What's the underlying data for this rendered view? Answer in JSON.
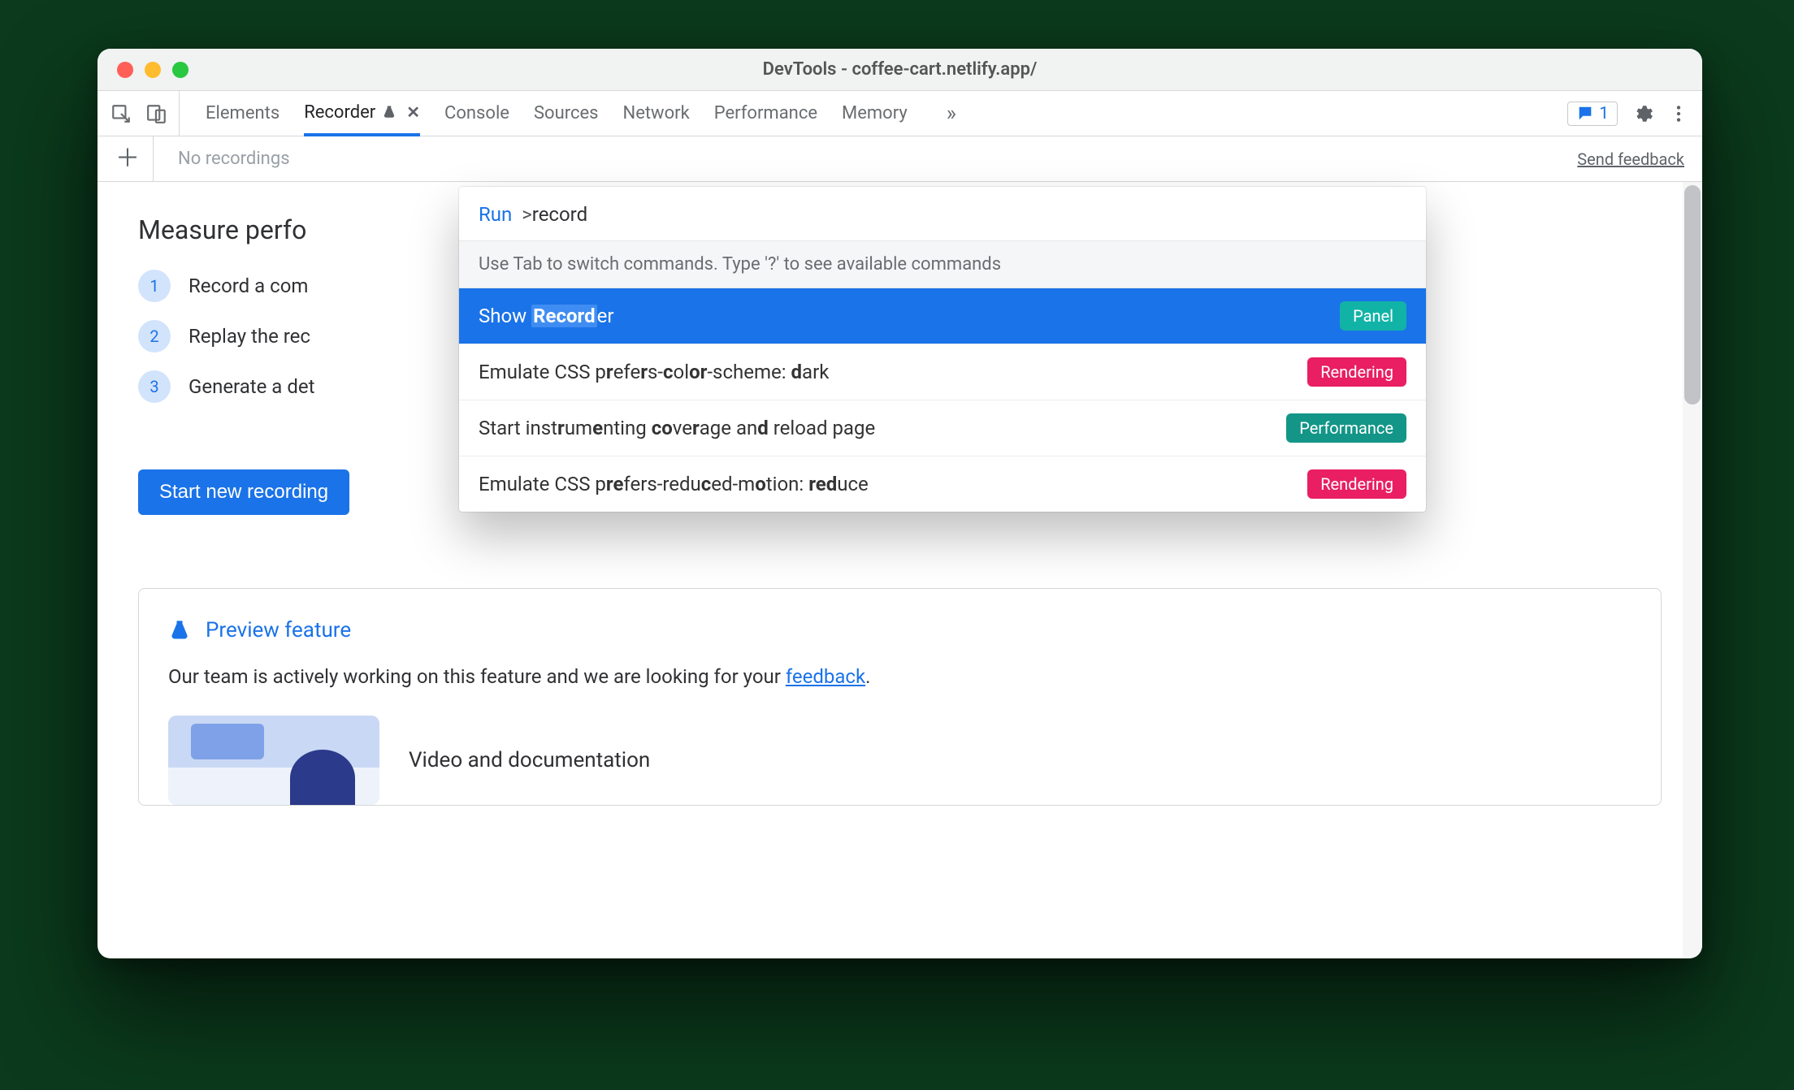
{
  "window": {
    "title": "DevTools - coffee-cart.netlify.app/"
  },
  "toolbar": {
    "tabs": [
      "Elements",
      "Recorder",
      "Console",
      "Sources",
      "Network",
      "Performance",
      "Memory"
    ],
    "messages_count": "1"
  },
  "secondary": {
    "no_recordings": "No recordings",
    "send_feedback": "Send feedback"
  },
  "content": {
    "heading": "Measure perfo",
    "steps": [
      "Record a com",
      "Replay the rec",
      "Generate a det"
    ],
    "start_button": "Start new recording"
  },
  "preview": {
    "title": "Preview feature",
    "desc_before": "Our team is actively working on this feature and we are looking for your ",
    "feedback_link": "feedback",
    "desc_after": ".",
    "media_title": "Video and documentation"
  },
  "palette": {
    "run_label": "Run",
    "prompt_prefix": ">",
    "query": "record",
    "hint": "Use Tab to switch commands. Type '?' to see available commands",
    "items": [
      {
        "label_before": "Show ",
        "highlight": "Record",
        "label_after": "er",
        "badge": "Panel",
        "badge_kind": "panel",
        "selected": true
      },
      {
        "raw_html": "Emulate CSS p<b>r</b>efe<b>r</b>s-<b>c</b>ol<b>or</b>-scheme: <b>d</b>ark",
        "badge": "Rendering",
        "badge_kind": "render",
        "selected": false
      },
      {
        "raw_html": "Start inst<b>r</b>um<b>e</b>nting <b>co</b>ve<b>r</b>age an<b>d</b> reload page",
        "badge": "Performance",
        "badge_kind": "perf",
        "selected": false
      },
      {
        "raw_html": "Emulate CSS p<b>re</b>fers-redu<b>c</b>ed-m<b>o</b>tion: <b>red</b>uce",
        "badge": "Rendering",
        "badge_kind": "render",
        "selected": false
      }
    ]
  }
}
